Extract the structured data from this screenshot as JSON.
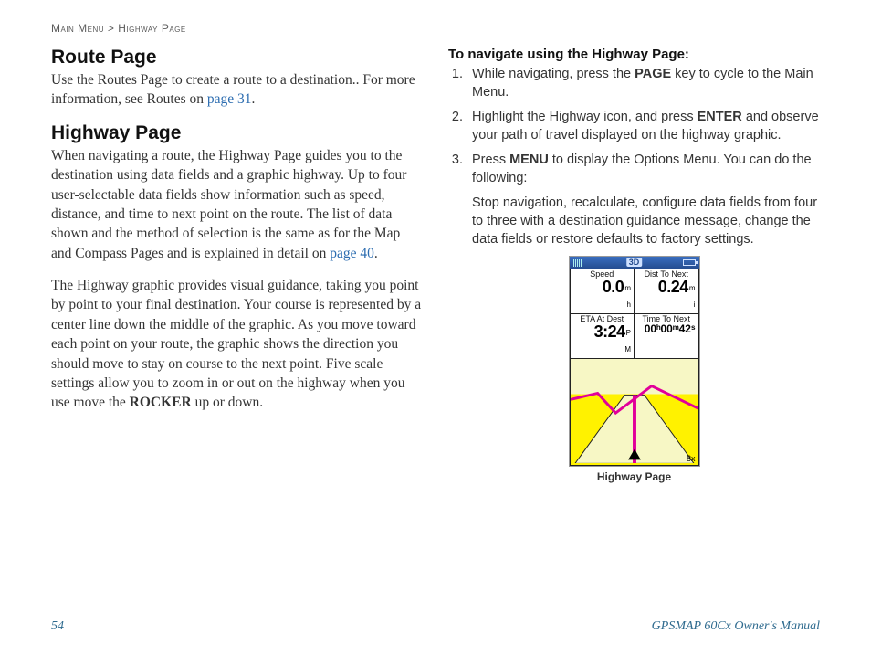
{
  "breadcrumb": {
    "parent": "Main Menu",
    "sep": ">",
    "current": "Highway Page"
  },
  "left": {
    "route": {
      "heading": "Route Page",
      "text_before_link": "Use the Routes Page to create a route to a destination.. For more information, see Routes on ",
      "link": "page 31",
      "text_after_link": "."
    },
    "highway": {
      "heading": "Highway Page",
      "p1_before": "When navigating a route, the Highway Page guides you to the destination using data fields and a graphic highway. Up to four user-selectable data fields show information such as speed, distance, and time to next point on the route. The list of data shown and the method of selection is the same as for the Map and Compass Pages and is explained in detail on ",
      "p1_link": "page 40",
      "p1_after": ".",
      "p2_before": "The Highway graphic provides visual guidance, taking you point by point to your final destination. Your course is represented by a center line down the middle of the graphic. As you move toward each point on your route, the graphic shows the direction you should move to stay on course to the next point. Five scale settings allow you to zoom in or out on the highway when you use move the ",
      "p2_bold": "ROCKER",
      "p2_after": " up or down."
    }
  },
  "right": {
    "heading": "To navigate using the Highway Page:",
    "steps": [
      {
        "pre": "While navigating, press the ",
        "bold": "PAGE",
        "post": " key to cycle to the Main Menu."
      },
      {
        "pre": "Highlight the Highway icon, and press ",
        "bold": "ENTER",
        "post": " and observe your path of travel displayed on the highway graphic."
      },
      {
        "pre": "Press ",
        "bold": "MENU",
        "post": " to display the Options Menu. You can do the following:"
      }
    ],
    "step3_extra": "Stop navigation, recalculate, configure data fields from four to three with a destination guidance message, change the data fields or restore defaults to factory settings.",
    "figure": {
      "caption": "Highway Page",
      "top_tag": "3D",
      "cells": {
        "speed_label": "Speed",
        "speed_value": "0.0",
        "speed_unit1": "m",
        "speed_unit2": "h",
        "dist_label": "Dist To Next",
        "dist_value": "0.24",
        "dist_unit": "m i",
        "eta_label": "ETA At Dest",
        "eta_value": "3:24",
        "eta_unit": "P M",
        "ttn_label": "Time To Next",
        "ttn_value": "00ʰ00ᵐ42ˢ"
      },
      "zoom": "8x"
    }
  },
  "footer": {
    "page": "54",
    "manual": "GPSMAP 60Cx Owner's Manual"
  }
}
